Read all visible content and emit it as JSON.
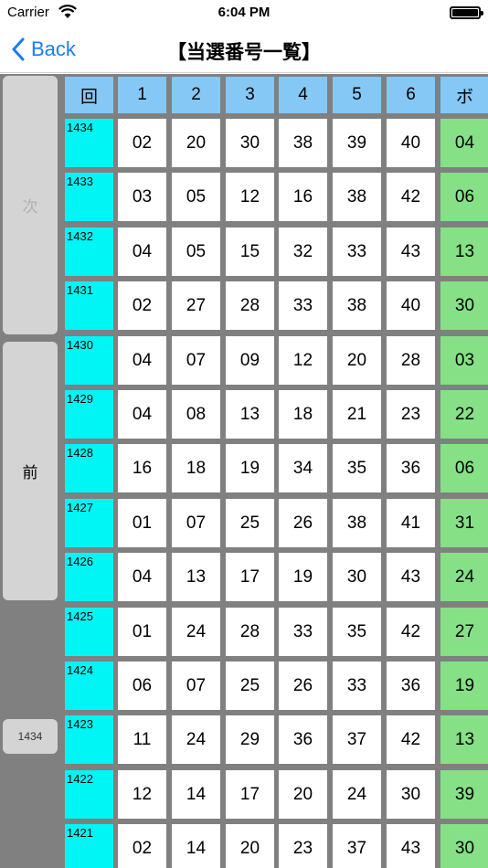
{
  "status_bar": {
    "carrier": "Carrier",
    "time": "6:04 PM"
  },
  "nav": {
    "back_label": "Back",
    "title": "【当選番号一覧】"
  },
  "side": {
    "next_label": "次",
    "prev_label": "前",
    "current_round": "1434"
  },
  "table": {
    "headers": [
      "回",
      "1",
      "2",
      "3",
      "4",
      "5",
      "6",
      "ボ"
    ],
    "rows": [
      {
        "round": "1434",
        "numbers": [
          "02",
          "20",
          "30",
          "38",
          "39",
          "40"
        ],
        "bonus": "04"
      },
      {
        "round": "1433",
        "numbers": [
          "03",
          "05",
          "12",
          "16",
          "38",
          "42"
        ],
        "bonus": "06"
      },
      {
        "round": "1432",
        "numbers": [
          "04",
          "05",
          "15",
          "32",
          "33",
          "43"
        ],
        "bonus": "13"
      },
      {
        "round": "1431",
        "numbers": [
          "02",
          "27",
          "28",
          "33",
          "38",
          "40"
        ],
        "bonus": "30"
      },
      {
        "round": "1430",
        "numbers": [
          "04",
          "07",
          "09",
          "12",
          "20",
          "28"
        ],
        "bonus": "03"
      },
      {
        "round": "1429",
        "numbers": [
          "04",
          "08",
          "13",
          "18",
          "21",
          "23"
        ],
        "bonus": "22"
      },
      {
        "round": "1428",
        "numbers": [
          "16",
          "18",
          "19",
          "34",
          "35",
          "36"
        ],
        "bonus": "06"
      },
      {
        "round": "1427",
        "numbers": [
          "01",
          "07",
          "25",
          "26",
          "38",
          "41"
        ],
        "bonus": "31"
      },
      {
        "round": "1426",
        "numbers": [
          "04",
          "13",
          "17",
          "19",
          "30",
          "43"
        ],
        "bonus": "24"
      },
      {
        "round": "1425",
        "numbers": [
          "01",
          "24",
          "28",
          "33",
          "35",
          "42"
        ],
        "bonus": "27"
      },
      {
        "round": "1424",
        "numbers": [
          "06",
          "07",
          "25",
          "26",
          "33",
          "36"
        ],
        "bonus": "19"
      },
      {
        "round": "1423",
        "numbers": [
          "11",
          "24",
          "29",
          "36",
          "37",
          "42"
        ],
        "bonus": "13"
      },
      {
        "round": "1422",
        "numbers": [
          "12",
          "14",
          "17",
          "20",
          "24",
          "30"
        ],
        "bonus": "39"
      },
      {
        "round": "1421",
        "numbers": [
          "02",
          "14",
          "20",
          "23",
          "37",
          "43"
        ],
        "bonus": "30"
      }
    ]
  },
  "colors": {
    "header": "#85c8f5",
    "round": "#00f5f5",
    "bonus": "#86e086",
    "background": "#808080",
    "accent": "#1a7cf5"
  }
}
